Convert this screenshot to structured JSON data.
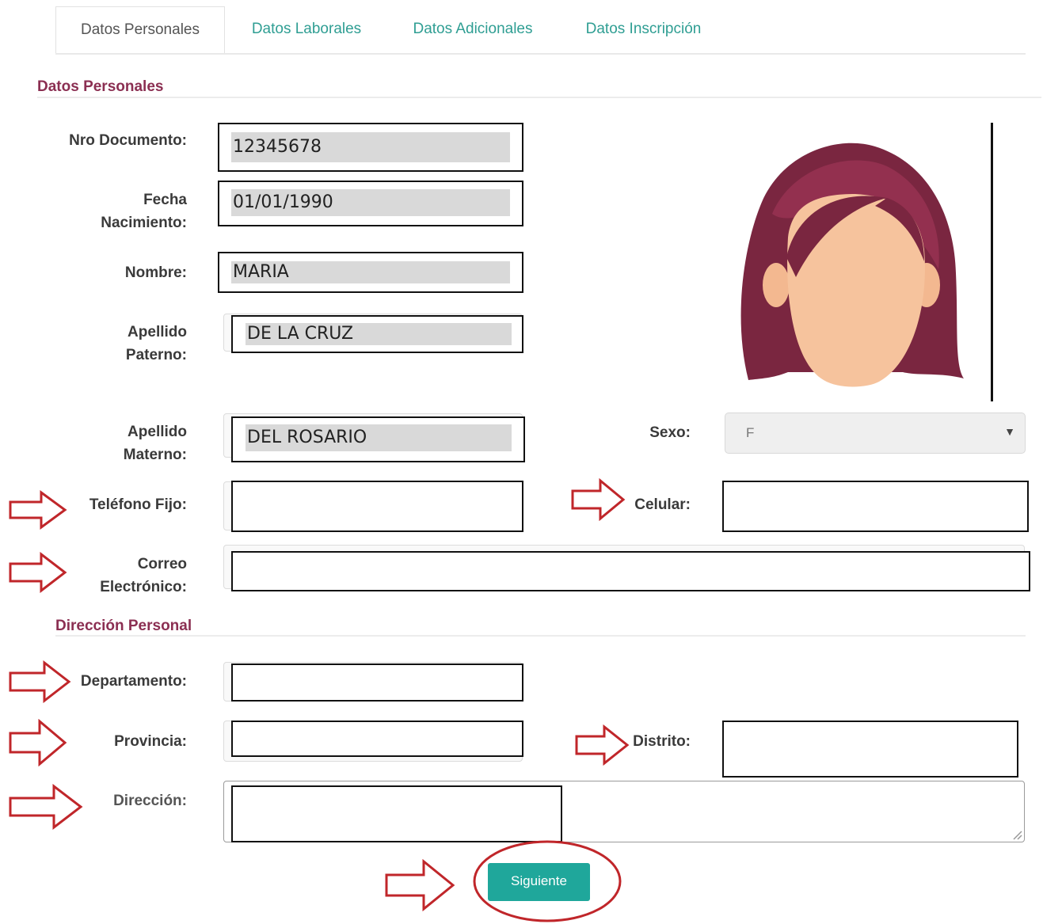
{
  "tabs": [
    {
      "label": "Datos Personales"
    },
    {
      "label": "Datos Laborales"
    },
    {
      "label": "Datos Adicionales"
    },
    {
      "label": "Datos Inscripción"
    }
  ],
  "section_personal": "Datos Personales",
  "section_address": "Dirección Personal",
  "labels": {
    "nro_documento": "Nro Documento:",
    "fecha_1": "Fecha",
    "fecha_2": "Nacimiento:",
    "nombre": "Nombre:",
    "ap_paterno_1": "Apellido",
    "ap_paterno_2": "Paterno:",
    "ap_materno_1": "Apellido",
    "ap_materno_2": "Materno:",
    "sexo": "Sexo:",
    "telefono": "Teléfono Fijo:",
    "celular": "Celular:",
    "correo_1": "Correo",
    "correo_2": "Electrónico:",
    "departamento": "Departamento:",
    "provincia": "Provincia:",
    "distrito": "Distrito:",
    "direccion": "Dirección:"
  },
  "values": {
    "nro_documento": "12345678",
    "fecha_nacimiento": "01/01/1990",
    "nombre": "MARIA",
    "apellido_paterno": "DE LA CRUZ",
    "apellido_materno": "DEL ROSARIO",
    "sexo": "F",
    "telefono": "",
    "celular": "",
    "correo": "",
    "departamento": "",
    "provincia": "",
    "distrito": "",
    "direccion": ""
  },
  "button_siguiente": "Siguiente",
  "colors": {
    "accent": "#1fa79b",
    "section": "#8b2f52",
    "annotation": "#c0262a",
    "hair": "#7a2640",
    "skin": "#f6c39d"
  },
  "icons": [
    "female-avatar-icon",
    "annotation-arrow-icon",
    "dropdown-caret-icon"
  ]
}
